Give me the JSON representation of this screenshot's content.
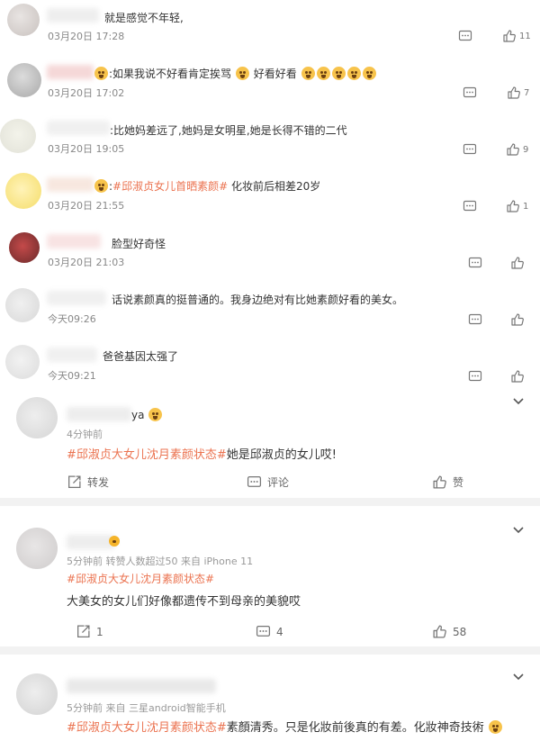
{
  "comments": [
    {
      "text": "就是感觉不年轻,",
      "time": "03月20日 17:28",
      "likes": "11"
    },
    {
      "text_pre": ":如果我说不好看肯定挨骂",
      "text_mid": "好看好看",
      "time": "03月20日 17:02",
      "likes": "7"
    },
    {
      "text": ":比她妈差远了,她妈是女明星,她是长得不错的二代",
      "time": "03月20日 19:05",
      "likes": "9"
    },
    {
      "text_pre": ":",
      "topic": "#邱淑贞女儿首晒素颜#",
      "text_post": "化妆前后相差20岁",
      "time": "03月20日 21:55",
      "likes": "1"
    },
    {
      "text": "脸型好奇怪",
      "time": "03月20日 21:03",
      "likes": ""
    },
    {
      "text": "话说素颜真的挺普通的。我身边绝对有比她素颜好看的美女。",
      "time": "今天09:26",
      "likes": ""
    },
    {
      "text": "爸爸基因太强了",
      "time": "今天09:21",
      "likes": ""
    }
  ],
  "posts": [
    {
      "name_suffix": "ya",
      "meta": "4分钟前",
      "topic": "#邱淑贞大女儿沈月素颜状态#",
      "body": "她是邱淑贞的女儿哎!",
      "repost_label": "转发",
      "comment_label": "评论",
      "like_label": "赞"
    },
    {
      "meta": "5分钟前 转赞人数超过50 来自 iPhone 11",
      "topic": "#邱淑贞大女儿沈月素颜状态#",
      "body": "大美女的女儿们好像都遗传不到母亲的美貌哎",
      "repost_count": "1",
      "comment_count": "4",
      "like_count": "58"
    },
    {
      "meta": "5分钟前 来自 三星android智能手机",
      "topic": "#邱淑贞大女儿沈月素颜状态#",
      "body": "素顏清秀。只是化妝前後真的有差。化妝神奇技術"
    }
  ],
  "colors": {
    "topic": "#eb7350",
    "meta": "#999999",
    "divider": "#f2f2f2"
  },
  "icons": [
    "comment-icon",
    "thumbs-up-icon",
    "repost-icon",
    "chevron-down-icon",
    "emoji-icon"
  ]
}
